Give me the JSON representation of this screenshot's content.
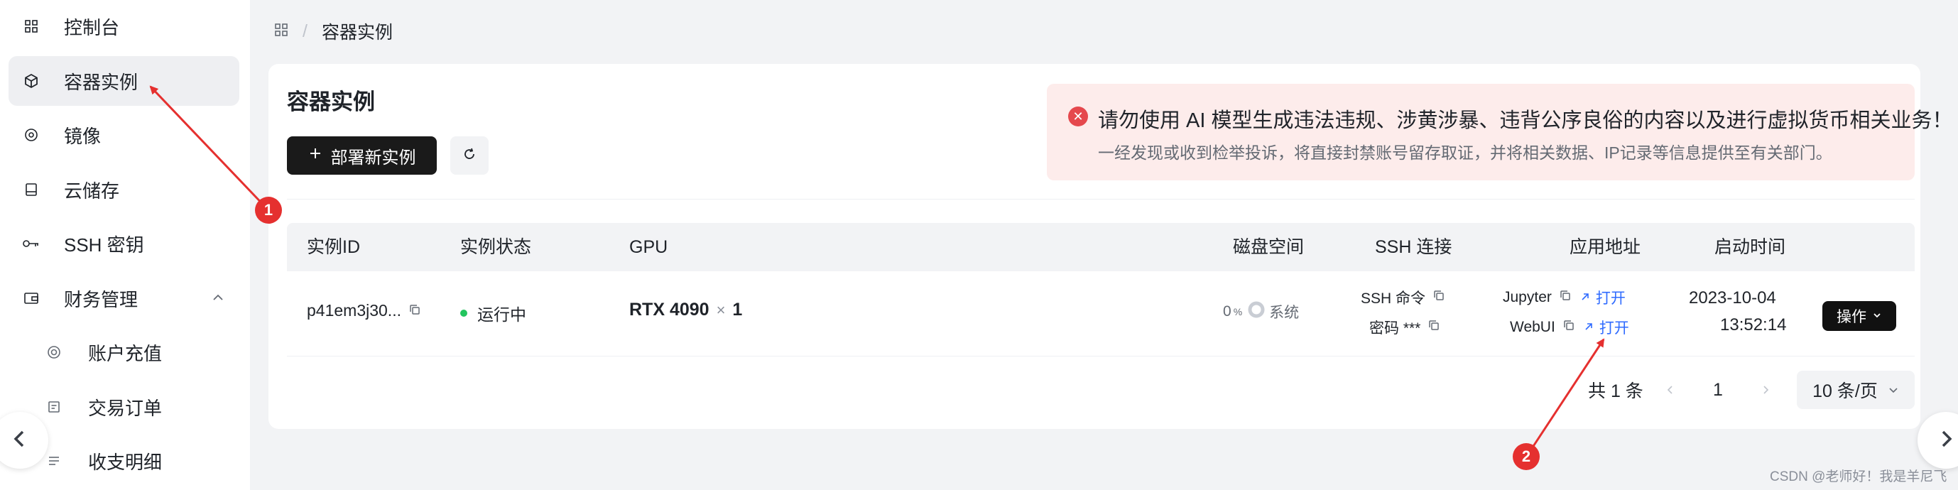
{
  "sidebar": {
    "items": [
      {
        "label": "控制台",
        "icon": "dashboard-icon"
      },
      {
        "label": "容器实例",
        "icon": "container-icon"
      },
      {
        "label": "镜像",
        "icon": "image-icon"
      },
      {
        "label": "云储存",
        "icon": "storage-icon"
      },
      {
        "label": "SSH 密钥",
        "icon": "key-icon"
      },
      {
        "label": "财务管理",
        "icon": "wallet-icon"
      },
      {
        "label": "账户充值",
        "icon": "recharge-icon"
      },
      {
        "label": "交易订单",
        "icon": "order-icon"
      },
      {
        "label": "收支明细",
        "icon": "ledger-icon"
      }
    ]
  },
  "breadcrumb": {
    "current": "容器实例",
    "separator": "/"
  },
  "page": {
    "title": "容器实例",
    "deploy_label": "部署新实例",
    "alert_title": "请勿使用 AI 模型生成违法违规、涉黄涉暴、违背公序良俗的内容以及进行虚拟货币相关业务！",
    "alert_desc": "一经发现或收到检举投诉，将直接封禁账号留存取证，并将相关数据、IP记录等信息提供至有关部门。"
  },
  "table": {
    "headers": [
      "实例ID",
      "实例状态",
      "GPU",
      "磁盘空间",
      "SSH 连接",
      "应用地址",
      "启动时间"
    ],
    "row": {
      "id": "p41em3j30...",
      "status": "运行中",
      "gpu_model": "RTX 4090",
      "gpu_times": "×",
      "gpu_count": "1",
      "disk_value": "0",
      "disk_unit": "%",
      "disk_label": "系统",
      "ssh_cmd": "SSH 命令",
      "ssh_pwd": "密码 ***",
      "app1_name": "Jupyter",
      "app1_open": "打开",
      "app2_name": "WebUI",
      "app2_open": "打开",
      "start_date": "2023-10-04",
      "start_time": "13:52:14",
      "ops_label": "操作"
    }
  },
  "pagination": {
    "total": "共 1 条",
    "current_page": "1",
    "page_size": "10 条/页"
  },
  "annotations": {
    "marker1": "1",
    "marker2": "2"
  },
  "watermark": "CSDN @老师好！我是羊尼飞",
  "colors": {
    "accent": "#2f6bff",
    "success": "#22c55e",
    "danger": "#e5484d",
    "annotation": "#e5302f"
  }
}
